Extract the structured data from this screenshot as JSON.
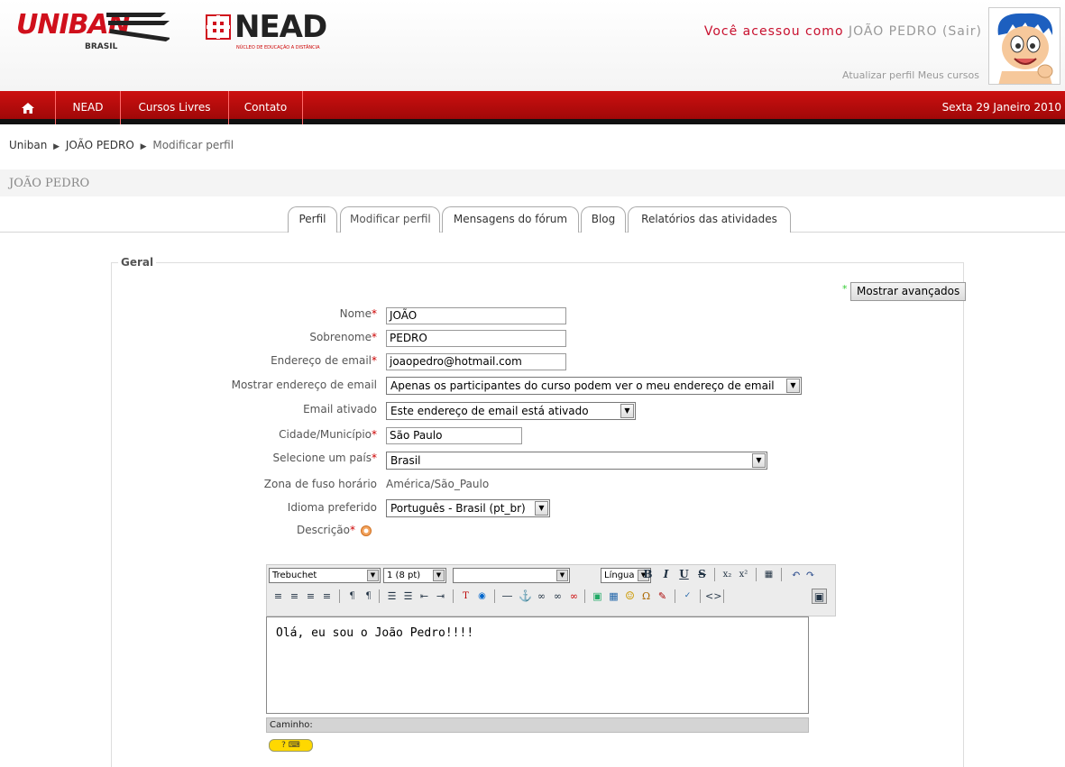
{
  "header": {
    "logo_uniban": "UNIBAN",
    "logo_uniban_sub": "BRASIL",
    "logo_nead": "NEAD",
    "logo_nead_sub": "NÚCLEO DE EDUCAÇÃO A DISTÂNCIA",
    "logged_in_prefix": "Você acessou como ",
    "logged_in_name": "JOÃO PEDRO",
    "logout_label": "(Sair)",
    "update_profile_link": "Atualizar perfil",
    "my_courses_link": "Meus cursos"
  },
  "navbar": {
    "home_icon": "home-icon",
    "items": [
      "NEAD",
      "Cursos Livres",
      "Contato"
    ],
    "date": "Sexta 29 Janeiro 2010"
  },
  "breadcrumb": [
    "Uniban",
    "JOÃO PEDRO",
    "Modificar perfil"
  ],
  "page_title": "JOÃO PEDRO",
  "tabs": [
    {
      "label": "Perfil",
      "active": false
    },
    {
      "label": "Modificar perfil",
      "active": true
    },
    {
      "label": "Mensagens do fórum",
      "active": false
    },
    {
      "label": "Blog",
      "active": false
    },
    {
      "label": "Relatórios das atividades",
      "active": false
    }
  ],
  "form": {
    "legend": "Geral",
    "advanced_button": "Mostrar avançados",
    "fields": {
      "first_name": {
        "label": "Nome",
        "value": "JOÃO"
      },
      "last_name": {
        "label": "Sobrenome",
        "value": "PEDRO"
      },
      "email": {
        "label": "Endereço de email",
        "value": "joaopedro@hotmail.com"
      },
      "email_display": {
        "label": "Mostrar endereço de email",
        "value": "Apenas os participantes do curso podem ver o meu endereço de email"
      },
      "email_enabled": {
        "label": "Email ativado",
        "value": "Este endereço de email está ativado"
      },
      "city": {
        "label": "Cidade/Município",
        "value": "São Paulo"
      },
      "country": {
        "label": "Selecione um país",
        "value": "Brasil"
      },
      "timezone": {
        "label": "Zona de fuso horário",
        "value": "América/São_Paulo"
      },
      "language": {
        "label": "Idioma preferido",
        "value": "Português - Brasil (pt_br)"
      },
      "description": {
        "label": "Descrição"
      }
    }
  },
  "editor": {
    "font_family": "Trebuchet",
    "font_size": "1 (8 pt)",
    "format": "",
    "language": "Língua",
    "content": "Olá, eu sou o João Pedro!!!!",
    "path_label": "Caminho:"
  },
  "colors": {
    "brand_red": "#c8102e",
    "navbar_red": "#b60c0c",
    "required": "#cc0000"
  }
}
